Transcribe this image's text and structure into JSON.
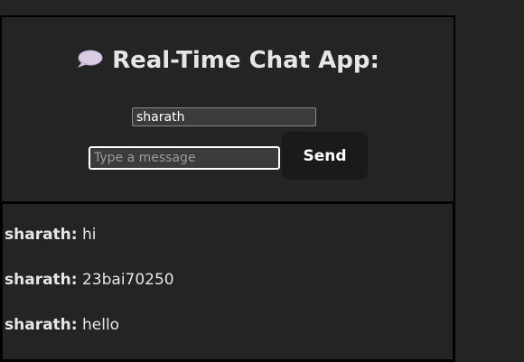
{
  "header": {
    "title": "Real-Time Chat App:",
    "icon": "speech-bubble-icon"
  },
  "form": {
    "name_value": "sharath",
    "message_value": "",
    "message_placeholder": "Type a message",
    "send_label": "Send"
  },
  "messages": [
    {
      "sender": "sharath:",
      "text": "hi"
    },
    {
      "sender": "sharath:",
      "text": "23bai70250"
    },
    {
      "sender": "sharath:",
      "text": "hello"
    }
  ],
  "colors": {
    "background": "#242424",
    "border": "#000000",
    "button": "#1a1a1a",
    "text": "#e6e6e6"
  }
}
